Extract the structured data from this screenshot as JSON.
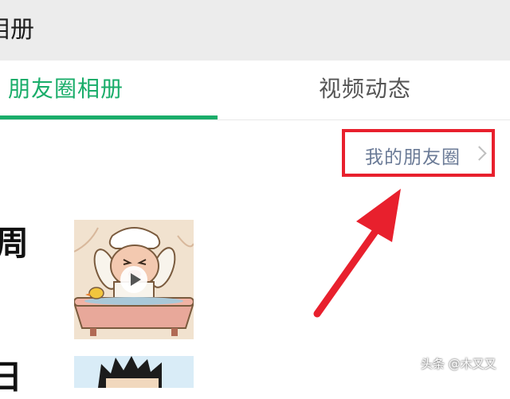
{
  "header": {
    "title": "相册"
  },
  "tabs": [
    {
      "label": "朋友圈相册",
      "active": true
    },
    {
      "label": "视频动态",
      "active": false
    }
  ],
  "my_moments_link": {
    "label": "我的朋友圈"
  },
  "feed": {
    "week_label": "周",
    "day_label": "日",
    "items": [
      {
        "type": "video",
        "icon": "play-icon"
      },
      {
        "type": "image"
      }
    ]
  },
  "watermark": {
    "text": "头条 @木又又"
  },
  "colors": {
    "accent": "#1aad6a",
    "highlight": "#e8202d",
    "link": "#6a7a96"
  }
}
